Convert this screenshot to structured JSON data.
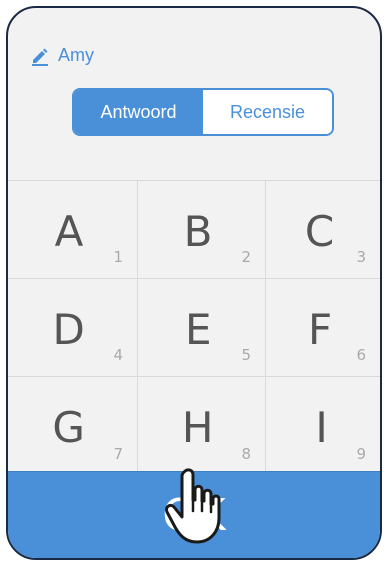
{
  "user": {
    "name": "Amy",
    "icon": "pencil-icon"
  },
  "tabs": [
    {
      "label": "Antwoord",
      "active": true
    },
    {
      "label": "Recensie",
      "active": false
    }
  ],
  "keys": [
    {
      "letter": "A",
      "number": "1"
    },
    {
      "letter": "B",
      "number": "2"
    },
    {
      "letter": "C",
      "number": "3"
    },
    {
      "letter": "D",
      "number": "4"
    },
    {
      "letter": "E",
      "number": "5"
    },
    {
      "letter": "F",
      "number": "6"
    },
    {
      "letter": "G",
      "number": "7"
    },
    {
      "letter": "H",
      "number": "8"
    },
    {
      "letter": "I",
      "number": "9"
    }
  ],
  "ok_label": "OK",
  "colors": {
    "accent": "#4a90d9",
    "background": "#f2f2f2",
    "frame": "#1a2a44"
  }
}
